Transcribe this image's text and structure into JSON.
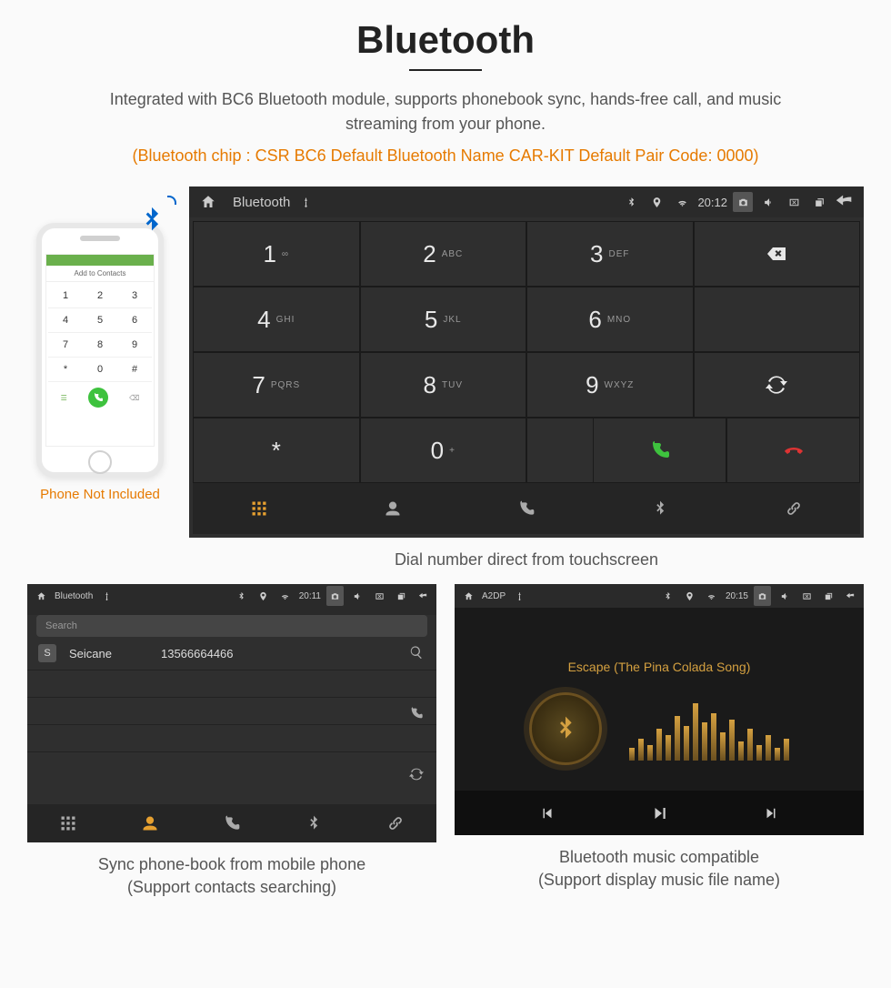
{
  "hero": {
    "title": "Bluetooth",
    "desc": "Integrated with BC6 Bluetooth module, supports phonebook sync, hands-free call, and music streaming from your phone.",
    "bt_info": "(Bluetooth chip : CSR BC6    Default Bluetooth Name CAR-KIT    Default Pair Code: 0000)"
  },
  "phone_mock": {
    "add_contacts": "Add to Contacts",
    "caption": "Phone Not Included"
  },
  "dialpad": {
    "topbar": {
      "title": "Bluetooth",
      "time": "20:12"
    },
    "keys": [
      {
        "n": "1",
        "s": "∞"
      },
      {
        "n": "2",
        "s": "ABC"
      },
      {
        "n": "3",
        "s": "DEF"
      },
      {
        "n": "4",
        "s": "GHI"
      },
      {
        "n": "5",
        "s": "JKL"
      },
      {
        "n": "6",
        "s": "MNO"
      },
      {
        "n": "7",
        "s": "PQRS"
      },
      {
        "n": "8",
        "s": "TUV"
      },
      {
        "n": "9",
        "s": "WXYZ"
      },
      {
        "n": "*",
        "s": ""
      },
      {
        "n": "0",
        "s": "+"
      },
      {
        "n": "#",
        "s": ""
      }
    ],
    "caption": "Dial number direct from touchscreen"
  },
  "phonebook": {
    "topbar": {
      "title": "Bluetooth",
      "time": "20:11"
    },
    "search_placeholder": "Search",
    "contact": {
      "initial": "S",
      "name": "Seicane",
      "number": "13566664466"
    },
    "caption_l1": "Sync phone-book from mobile phone",
    "caption_l2": "(Support contacts searching)"
  },
  "music": {
    "topbar": {
      "title": "A2DP",
      "time": "20:15"
    },
    "song": "Escape (The Pina Colada Song)",
    "caption_l1": "Bluetooth music compatible",
    "caption_l2": "(Support display music file name)"
  }
}
